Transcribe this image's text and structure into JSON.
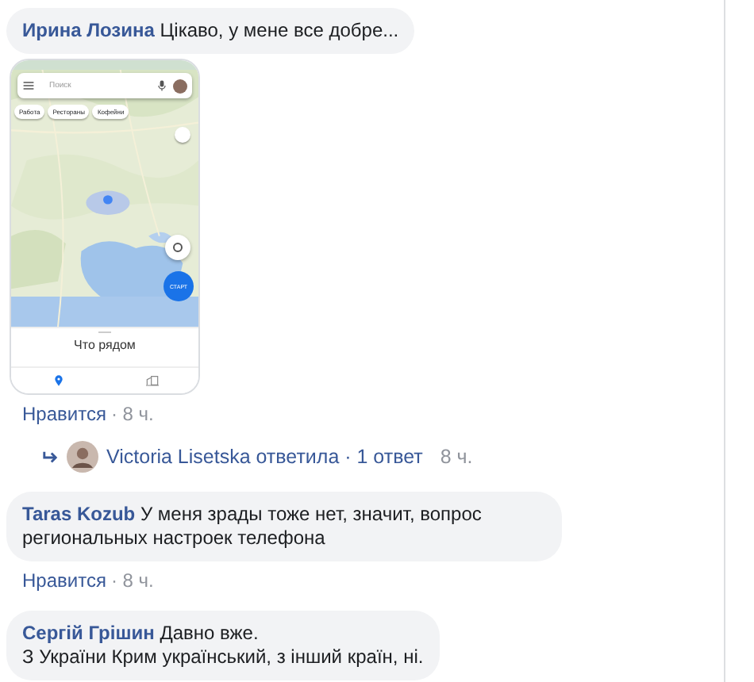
{
  "comments": [
    {
      "author": "Ирина Лозина",
      "text": "Цікаво, у мене все добре...",
      "attachment": {
        "kind": "phone_screenshot",
        "search_placeholder": "Поиск",
        "chips": [
          "Работа",
          "Рестораны",
          "Кофейни"
        ],
        "start_label": "СТАРТ",
        "sheet_title": "Что рядом",
        "nav": [
          {
            "kind": "pin",
            "selected": true
          },
          {
            "kind": "building",
            "selected": false
          }
        ]
      },
      "like": "Нравится",
      "time": "· 8 ч.",
      "reply": {
        "author": "Victoria Lisetska",
        "verb": "ответила",
        "count": "· 1 ответ",
        "time": "8 ч."
      }
    },
    {
      "author": "Taras Kozub",
      "text": "У меня зрады тоже нет, значит, вопрос региональных настроек телефона",
      "like": "Нравится",
      "time": "· 8 ч."
    },
    {
      "author": "Сергій Грішин",
      "lines": [
        "Давно вже.",
        "З України Крим український, з інший країн, ні."
      ]
    }
  ]
}
